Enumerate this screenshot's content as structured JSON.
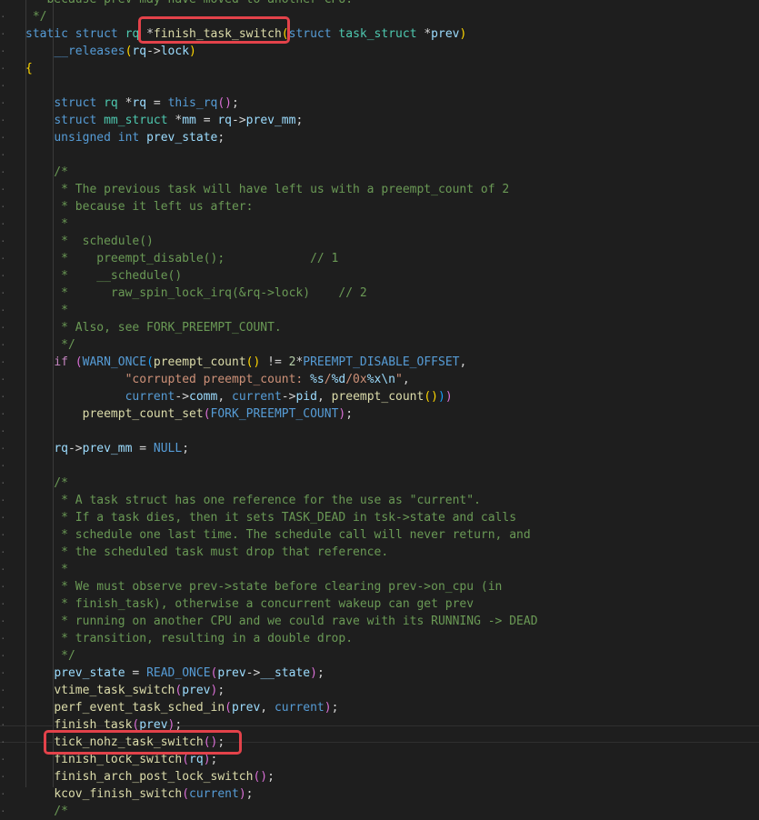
{
  "colors": {
    "background": "#1e1e1e",
    "keyword": "#569cd6",
    "type": "#4ec9b0",
    "variable": "#9cdcfe",
    "function": "#dcdcaa",
    "comment": "#6a9955",
    "string": "#ce9178",
    "number": "#b5cea8",
    "annotation_box": "#e3424a"
  },
  "annotations": [
    {
      "name": "highlight-box-finish-task-switch",
      "target": "*finish_task_switch("
    },
    {
      "name": "highlight-box-finish-lock-switch",
      "target": "finish_lock_switch(rq);"
    }
  ],
  "lines": [
    [
      {
        "t": " * because prev may have moved to another CPU.",
        "c": "cm"
      }
    ],
    [
      {
        "t": " */",
        "c": "cm"
      }
    ],
    [
      {
        "t": "static",
        "c": "kw"
      },
      {
        "t": " "
      },
      {
        "t": "struct",
        "c": "kw"
      },
      {
        "t": " "
      },
      {
        "t": "rq",
        "c": "type"
      },
      {
        "t": " *"
      },
      {
        "t": "finish_task_switch",
        "c": "fn"
      },
      {
        "t": "(",
        "c": "p1"
      },
      {
        "t": "struct",
        "c": "kw"
      },
      {
        "t": " "
      },
      {
        "t": "task_struct",
        "c": "type"
      },
      {
        "t": " *"
      },
      {
        "t": "prev",
        "c": "var"
      },
      {
        "t": ")",
        "c": "p1"
      }
    ],
    [
      {
        "t": "    "
      },
      {
        "t": "__releases",
        "c": "mac"
      },
      {
        "t": "(",
        "c": "p1"
      },
      {
        "t": "rq",
        "c": "var"
      },
      {
        "t": "->"
      },
      {
        "t": "lock",
        "c": "var"
      },
      {
        "t": ")",
        "c": "p1"
      }
    ],
    [
      {
        "t": "{",
        "c": "p1"
      }
    ],
    [],
    [
      {
        "t": "    "
      },
      {
        "t": "struct",
        "c": "kw"
      },
      {
        "t": " "
      },
      {
        "t": "rq",
        "c": "type"
      },
      {
        "t": " *"
      },
      {
        "t": "rq",
        "c": "var"
      },
      {
        "t": " = "
      },
      {
        "t": "this_rq",
        "c": "mac"
      },
      {
        "t": "()",
        "c": "p2"
      },
      {
        "t": ";"
      }
    ],
    [
      {
        "t": "    "
      },
      {
        "t": "struct",
        "c": "kw"
      },
      {
        "t": " "
      },
      {
        "t": "mm_struct",
        "c": "type"
      },
      {
        "t": " *"
      },
      {
        "t": "mm",
        "c": "var"
      },
      {
        "t": " = "
      },
      {
        "t": "rq",
        "c": "var"
      },
      {
        "t": "->"
      },
      {
        "t": "prev_mm",
        "c": "var"
      },
      {
        "t": ";"
      }
    ],
    [
      {
        "t": "    "
      },
      {
        "t": "unsigned",
        "c": "kw"
      },
      {
        "t": " "
      },
      {
        "t": "int",
        "c": "kw"
      },
      {
        "t": " "
      },
      {
        "t": "prev_state",
        "c": "var"
      },
      {
        "t": ";"
      }
    ],
    [],
    [
      {
        "t": "    /*",
        "c": "cm"
      }
    ],
    [
      {
        "t": "     * The previous task will have left us with a preempt_count of 2",
        "c": "cm"
      }
    ],
    [
      {
        "t": "     * because it left us after:",
        "c": "cm"
      }
    ],
    [
      {
        "t": "     *",
        "c": "cm"
      }
    ],
    [
      {
        "t": "     *  schedule()",
        "c": "cm"
      }
    ],
    [
      {
        "t": "     *    preempt_disable();            // 1",
        "c": "cm"
      }
    ],
    [
      {
        "t": "     *    __schedule()",
        "c": "cm"
      }
    ],
    [
      {
        "t": "     *      raw_spin_lock_irq(&rq->lock)    // 2",
        "c": "cm"
      }
    ],
    [
      {
        "t": "     *",
        "c": "cm"
      }
    ],
    [
      {
        "t": "     * Also, see FORK_PREEMPT_COUNT.",
        "c": "cm"
      }
    ],
    [
      {
        "t": "     */",
        "c": "cm"
      }
    ],
    [
      {
        "t": "    "
      },
      {
        "t": "if",
        "c": "ctl"
      },
      {
        "t": " "
      },
      {
        "t": "(",
        "c": "p2"
      },
      {
        "t": "WARN_ONCE",
        "c": "mac"
      },
      {
        "t": "(",
        "c": "p3"
      },
      {
        "t": "preempt_count",
        "c": "fn"
      },
      {
        "t": "()",
        "c": "p1"
      },
      {
        "t": " != "
      },
      {
        "t": "2",
        "c": "num"
      },
      {
        "t": "*"
      },
      {
        "t": "PREEMPT_DISABLE_OFFSET",
        "c": "mac"
      },
      {
        "t": ","
      }
    ],
    [
      {
        "t": "              "
      },
      {
        "t": "\"corrupted preempt_count: ",
        "c": "str"
      },
      {
        "t": "%s",
        "c": "fmt"
      },
      {
        "t": "/",
        "c": "str"
      },
      {
        "t": "%d",
        "c": "fmt"
      },
      {
        "t": "/0x",
        "c": "str"
      },
      {
        "t": "%x",
        "c": "fmt"
      },
      {
        "t": "\\n",
        "c": "fmt"
      },
      {
        "t": "\"",
        "c": "str"
      },
      {
        "t": ","
      }
    ],
    [
      {
        "t": "              "
      },
      {
        "t": "current",
        "c": "mac"
      },
      {
        "t": "->"
      },
      {
        "t": "comm",
        "c": "var"
      },
      {
        "t": ", "
      },
      {
        "t": "current",
        "c": "mac"
      },
      {
        "t": "->"
      },
      {
        "t": "pid",
        "c": "var"
      },
      {
        "t": ", "
      },
      {
        "t": "preempt_count",
        "c": "fn"
      },
      {
        "t": "()",
        "c": "p1"
      },
      {
        "t": ")",
        "c": "p3"
      },
      {
        "t": ")",
        "c": "p2"
      }
    ],
    [
      {
        "t": "        "
      },
      {
        "t": "preempt_count_set",
        "c": "fn"
      },
      {
        "t": "(",
        "c": "p2"
      },
      {
        "t": "FORK_PREEMPT_COUNT",
        "c": "mac"
      },
      {
        "t": ")",
        "c": "p2"
      },
      {
        "t": ";"
      }
    ],
    [],
    [
      {
        "t": "    "
      },
      {
        "t": "rq",
        "c": "var"
      },
      {
        "t": "->"
      },
      {
        "t": "prev_mm",
        "c": "var"
      },
      {
        "t": " = "
      },
      {
        "t": "NULL",
        "c": "mac"
      },
      {
        "t": ";"
      }
    ],
    [],
    [
      {
        "t": "    /*",
        "c": "cm"
      }
    ],
    [
      {
        "t": "     * A task struct has one reference for the use as \"current\".",
        "c": "cm"
      }
    ],
    [
      {
        "t": "     * If a task dies, then it sets TASK_DEAD in tsk->state and calls",
        "c": "cm"
      }
    ],
    [
      {
        "t": "     * schedule one last time. The schedule call will never return, and",
        "c": "cm"
      }
    ],
    [
      {
        "t": "     * the scheduled task must drop that reference.",
        "c": "cm"
      }
    ],
    [
      {
        "t": "     *",
        "c": "cm"
      }
    ],
    [
      {
        "t": "     * We must observe prev->state before clearing prev->on_cpu (in",
        "c": "cm"
      }
    ],
    [
      {
        "t": "     * finish_task), otherwise a concurrent wakeup can get prev",
        "c": "cm"
      }
    ],
    [
      {
        "t": "     * running on another CPU and we could rave with its RUNNING -> DEAD",
        "c": "cm"
      }
    ],
    [
      {
        "t": "     * transition, resulting in a double drop.",
        "c": "cm"
      }
    ],
    [
      {
        "t": "     */",
        "c": "cm"
      }
    ],
    [
      {
        "t": "    "
      },
      {
        "t": "prev_state",
        "c": "var"
      },
      {
        "t": " = "
      },
      {
        "t": "READ_ONCE",
        "c": "mac"
      },
      {
        "t": "(",
        "c": "p2"
      },
      {
        "t": "prev",
        "c": "var"
      },
      {
        "t": "->"
      },
      {
        "t": "__state",
        "c": "var"
      },
      {
        "t": ")",
        "c": "p2"
      },
      {
        "t": ";"
      }
    ],
    [
      {
        "t": "    "
      },
      {
        "t": "vtime_task_switch",
        "c": "fn"
      },
      {
        "t": "(",
        "c": "p2"
      },
      {
        "t": "prev",
        "c": "var"
      },
      {
        "t": ")",
        "c": "p2"
      },
      {
        "t": ";"
      }
    ],
    [
      {
        "t": "    "
      },
      {
        "t": "perf_event_task_sched_in",
        "c": "fn"
      },
      {
        "t": "(",
        "c": "p2"
      },
      {
        "t": "prev",
        "c": "var"
      },
      {
        "t": ", "
      },
      {
        "t": "current",
        "c": "mac"
      },
      {
        "t": ")",
        "c": "p2"
      },
      {
        "t": ";"
      }
    ],
    [
      {
        "t": "    "
      },
      {
        "t": "finish_task",
        "c": "fn"
      },
      {
        "t": "(",
        "c": "p2"
      },
      {
        "t": "prev",
        "c": "var"
      },
      {
        "t": ")",
        "c": "p2"
      },
      {
        "t": ";"
      }
    ],
    [
      {
        "t": "    "
      },
      {
        "t": "tick_nohz_task_switch",
        "c": "fn"
      },
      {
        "t": "()",
        "c": "p2"
      },
      {
        "t": ";"
      }
    ],
    [
      {
        "t": "    "
      },
      {
        "t": "finish_lock_switch",
        "c": "fn"
      },
      {
        "t": "(",
        "c": "p2"
      },
      {
        "t": "rq",
        "c": "var"
      },
      {
        "t": ")",
        "c": "p2"
      },
      {
        "t": ";"
      }
    ],
    [
      {
        "t": "    "
      },
      {
        "t": "finish_arch_post_lock_switch",
        "c": "fn"
      },
      {
        "t": "()",
        "c": "p2"
      },
      {
        "t": ";"
      }
    ],
    [
      {
        "t": "    "
      },
      {
        "t": "kcov_finish_switch",
        "c": "fn"
      },
      {
        "t": "(",
        "c": "p2"
      },
      {
        "t": "current",
        "c": "mac"
      },
      {
        "t": ")",
        "c": "p2"
      },
      {
        "t": ";"
      }
    ],
    [
      {
        "t": "    /*",
        "c": "cm"
      }
    ]
  ]
}
